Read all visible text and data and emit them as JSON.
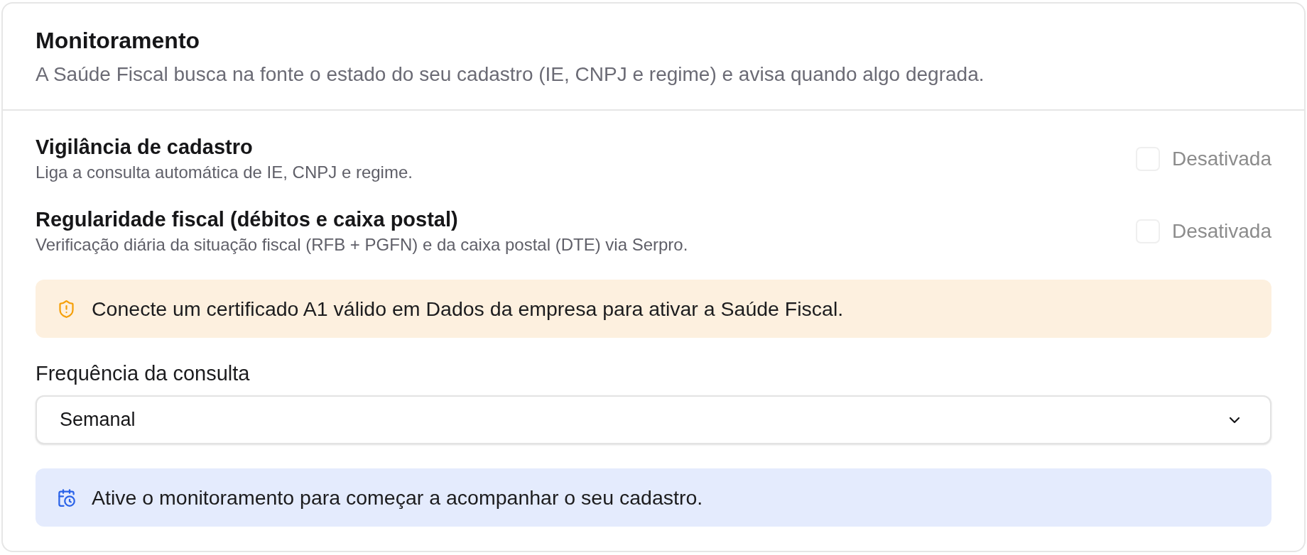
{
  "header": {
    "title": "Monitoramento",
    "description": "A Saúde Fiscal busca na fonte o estado do seu cadastro (IE, CNPJ e regime) e avisa quando algo degrada."
  },
  "settings": [
    {
      "title": "Vigilância de cadastro",
      "description": "Liga a consulta automática de IE, CNPJ e regime.",
      "checked": false,
      "disabled": true,
      "status": "Desativada"
    },
    {
      "title": "Regularidade fiscal (débitos e caixa postal)",
      "description": "Verificação diária da situação fiscal (RFB + PGFN) e da caixa postal (DTE) via Serpro.",
      "checked": false,
      "disabled": true,
      "status": "Desativada"
    }
  ],
  "warning_banner": {
    "kind": "warning",
    "text": "Conecte um certificado A1 válido em Dados da empresa para ativar a Saúde Fiscal."
  },
  "frequency": {
    "label": "Frequência da consulta",
    "value": "Semanal"
  },
  "info_banner": {
    "kind": "info",
    "text": "Ative o monitoramento para começar a acompanhar o seu cadastro."
  }
}
